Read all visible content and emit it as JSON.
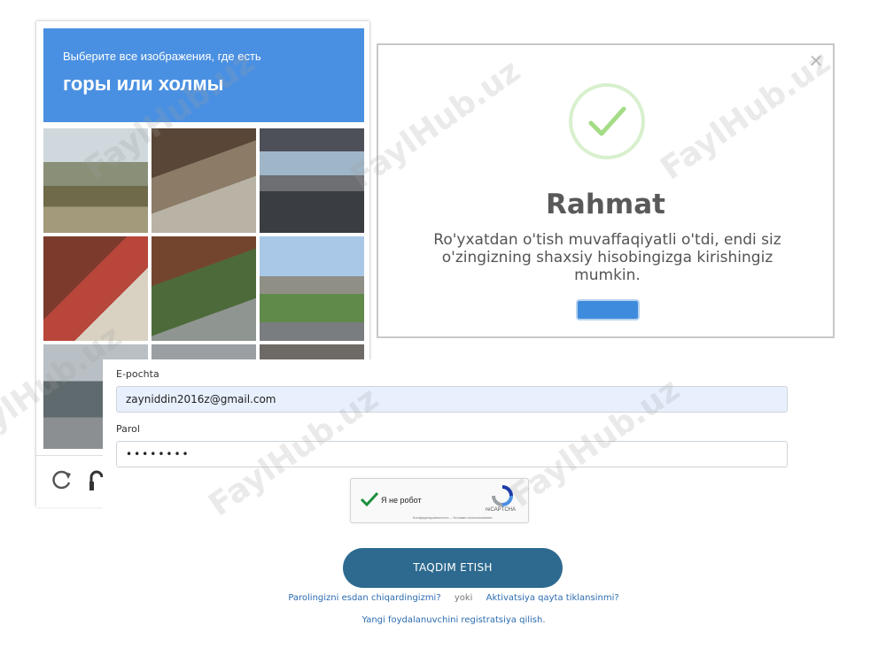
{
  "captcha": {
    "instruction": "Выберите все изображения, где есть",
    "target": "горы или холмы",
    "tiles": [
      "tile-1",
      "tile-2",
      "tile-3",
      "tile-4",
      "tile-5",
      "tile-6",
      "tile-7",
      "tile-8",
      "tile-9"
    ],
    "icons": {
      "reload": "reload-icon",
      "audio": "headphones-icon"
    },
    "header_color": "#4a90e2"
  },
  "modal": {
    "title": "Rahmat",
    "message": "Ro'yxatdan o'tish muvaffaqiyatli o'tdi, endi siz o'zingizning shaxsiy hisobingizga kirishingiz mumkin.",
    "ok_button_label": "",
    "icons": {
      "success": "check-circle-icon",
      "close": "close-icon"
    },
    "success_color": "#a5dc86",
    "button_color": "#3e8bde"
  },
  "form": {
    "email_label": "E-pochta",
    "email_value": "zayniddin2016z@gmail.com",
    "password_label": "Parol",
    "password_value": "••••••••",
    "recaptcha": {
      "label": "Я не робот",
      "brand": "reCAPTCHA",
      "terms": "Конфиденциальность – Условия использования",
      "checked": true
    },
    "submit_label": "TAQDIM ETISH",
    "submit_color": "#2e6a8f",
    "forgot_link": "Parolingizni esdan chiqardingizmi?",
    "or_text": "yoki",
    "reactivate_link": "Aktivatsiya qayta tiklansinmi?",
    "register_link": "Yangi foydalanuvchini registratsiya qilish."
  },
  "watermark": "FaylHub.uz"
}
